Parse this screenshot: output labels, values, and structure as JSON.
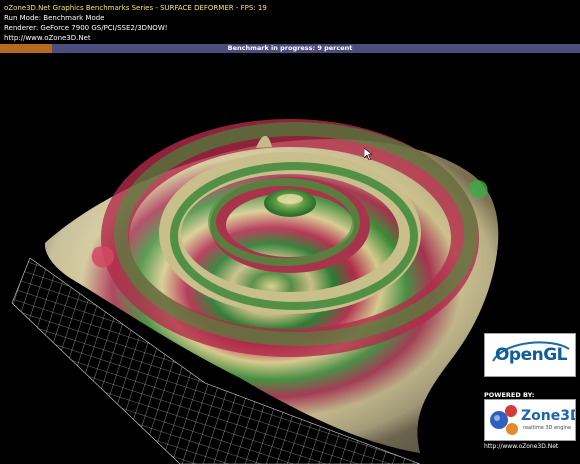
{
  "hud": {
    "title": "oZone3D.Net Graphics Benchmarks Series - SURFACE DEFORMER - FPS: 19",
    "run_mode": "Run Mode: Benchmark Mode",
    "renderer": "Renderer: GeForce 7900 GS/PCI/SSE2/3DNOW!",
    "url": "http://www.oZone3D.Net"
  },
  "progress": {
    "label": "Benchmark in progress: 9 percent",
    "percent": 9
  },
  "logos": {
    "opengl_text": "OpenGL",
    "powered_by": "POWERED BY:",
    "ozone_name": "Zone3D",
    "ozone_tagline": "realtime 3D engine",
    "ozone_url": "http://www.oZone3D.Net"
  },
  "colors": {
    "hud_title": "#f3e86a",
    "progress_fill": "#b76a1f",
    "progress_track": "#4b4d7e"
  },
  "icons": [
    "cursor-icon",
    "opengl-logo",
    "ozone3d-logo"
  ]
}
